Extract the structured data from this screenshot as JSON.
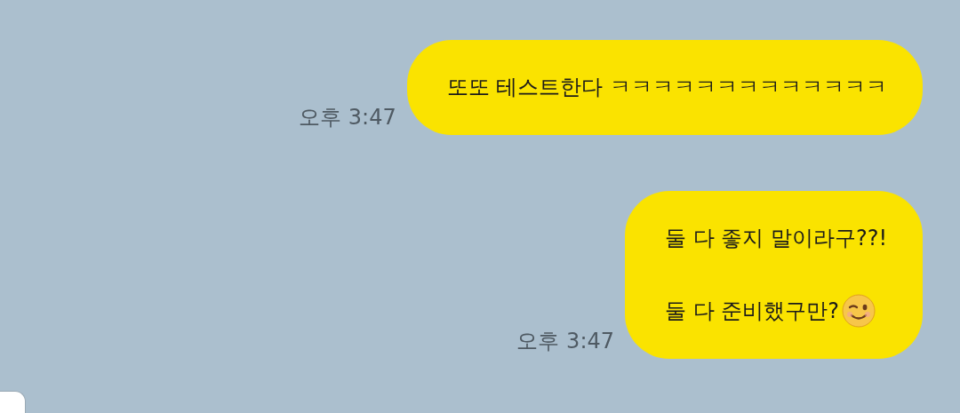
{
  "messages": [
    {
      "kind": "sent",
      "lines": [
        "또또 테스트한다 ㅋㅋㅋㅋㅋㅋㅋㅋㅋㅋㅋㅋㅋ"
      ],
      "time": "오후 3:47",
      "emoji": false
    },
    {
      "kind": "sent",
      "lines": [
        "둘 다 좋지 말이라구??!",
        "둘 다 준비했구만?"
      ],
      "time": "오후 3:47",
      "emoji": true
    }
  ]
}
